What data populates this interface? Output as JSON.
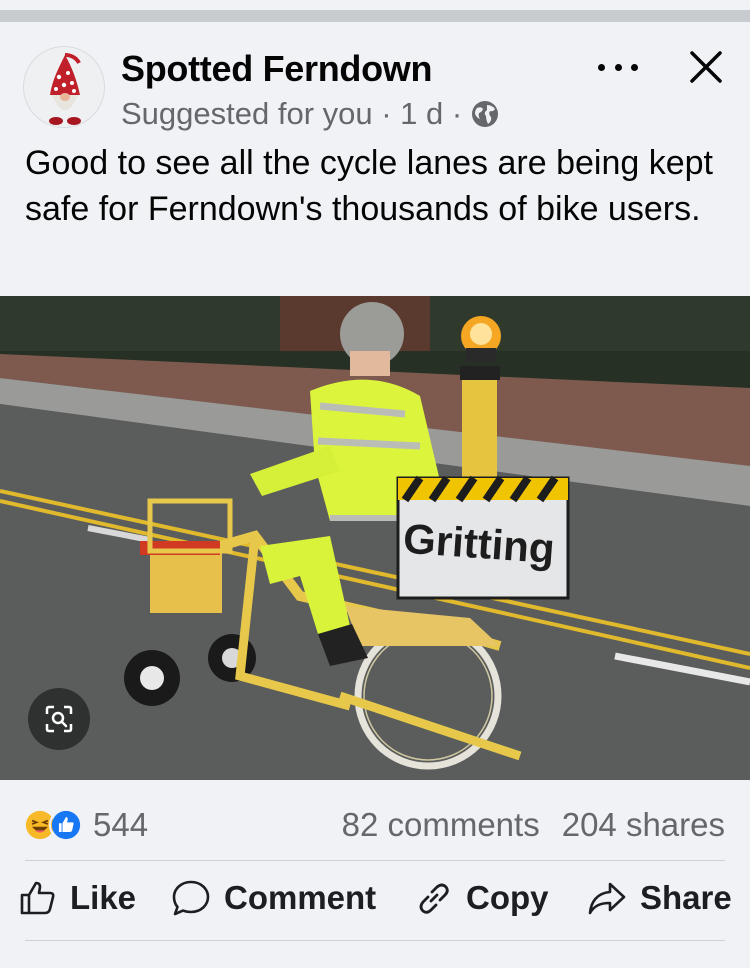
{
  "post": {
    "page_name": "Spotted Ferndown",
    "meta_text": "Suggested for you · 1 d ·",
    "body_text": "Good to see all the cycle lanes are being kept safe for Ferndown's thousands of bike users.",
    "photo_sign_text": "Gritting"
  },
  "reactions": {
    "icons": [
      "haha-icon",
      "like-icon"
    ],
    "count": "544"
  },
  "stats": {
    "comments": "82 comments",
    "shares": "204 shares"
  },
  "actions": {
    "like": "Like",
    "comment": "Comment",
    "copy": "Copy",
    "share": "Share"
  },
  "colors": {
    "background": "#f0f2f5",
    "text_primary": "#050505",
    "text_secondary": "#65676b",
    "like_blue": "#1877f2",
    "haha_yellow": "#f7b928"
  }
}
